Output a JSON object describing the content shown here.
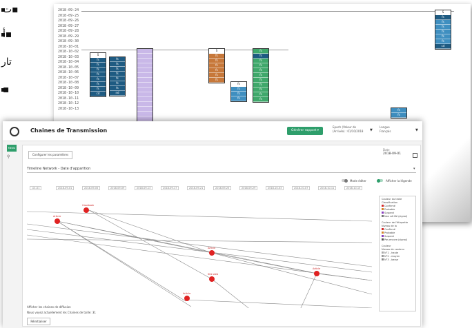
{
  "rtl": {
    "line1": "▪ت",
    "line2": "▪أ",
    "line3": "تار",
    "line4": "▪"
  },
  "back_timeline": {
    "dates": [
      "2018-09-24",
      "2018-09-25",
      "2018-09-26",
      "2018-09-27",
      "2018-09-28",
      "2018-09-29",
      "2018-09-30",
      "2018-10-01",
      "2018-10-02",
      "2018-10-03",
      "2018-10-04",
      "2018-10-05",
      "2018-10-06",
      "2018-10-07",
      "2018-10-08",
      "2018-10-09",
      "2018-10-10",
      "2018-10-11",
      "2018-10-12",
      "2018-10-13"
    ],
    "cells": {
      "s": "S",
      "fs": "fs",
      "cd": "cd",
      "nd": "nd",
      "ld": "L•"
    },
    "colors": {
      "dark_blue": "#1e5b82",
      "mid_blue": "#3f8fc0",
      "green": "#3fa86b",
      "orange": "#c7783a",
      "lavender": "#c9b8e8",
      "red": "#c0302a",
      "gray": "#6a6a6a"
    }
  },
  "app": {
    "title": "Chaines de Transmission",
    "green_button": "Générer rapport ▾",
    "epoch_label": "Epoch (Valeur de",
    "epoch_value": "(Arrivée) : 01/10/2018",
    "lang_label": "Langue",
    "lang_value": "Français",
    "menu": "MENU"
  },
  "panel": {
    "params_button": "Configurer les paramètres",
    "date_label": "Date",
    "date_value": "2018-09-01",
    "select_title": "Timeline Network - Date d'apparition",
    "toggle_editor": "Mode éditer",
    "toggle_legend": "Afficher la légende",
    "ticks": [
      "-01-01",
      "2018-09-01",
      "2018-09-05",
      "2018-09-09",
      "2018-09-13",
      "2018-09-17",
      "2018-09-21",
      "2018-09-25",
      "2018-09-29",
      "2018-10-03",
      "2018-10-07",
      "2018-10-11",
      "2018-10-15"
    ],
    "nodes": [
      {
        "label": "Casebook"
      },
      {
        "label": "Article"
      },
      {
        "label": "Article"
      },
      {
        "label": "Site web"
      },
      {
        "label": "Article"
      },
      {
        "label": "Article"
      }
    ],
    "bottom_label1": "Afficher les chaines de diffusion",
    "bottom_label2": "Nous voyez actuellement les Chaines de taille: 31",
    "reset_button": "Réinitialiser"
  },
  "legend": {
    "title1": "Couleur du texte",
    "sub1": "Classification",
    "items1": [
      "Confirmé",
      "Probable",
      "Suspect",
      "Non vérifié (signal)"
    ],
    "title2": "Couleur de l'étiquette",
    "sub2": "Niveau de la",
    "items2": [
      "Confirmé",
      "Probable",
      "Suspect",
      "Pas encore (signal)"
    ],
    "title3": "Couleur",
    "sub3": "Niveau de contenu",
    "items3": [
      "N°1 - haute",
      "N°2 - moyen",
      "N°3 - basse"
    ]
  }
}
